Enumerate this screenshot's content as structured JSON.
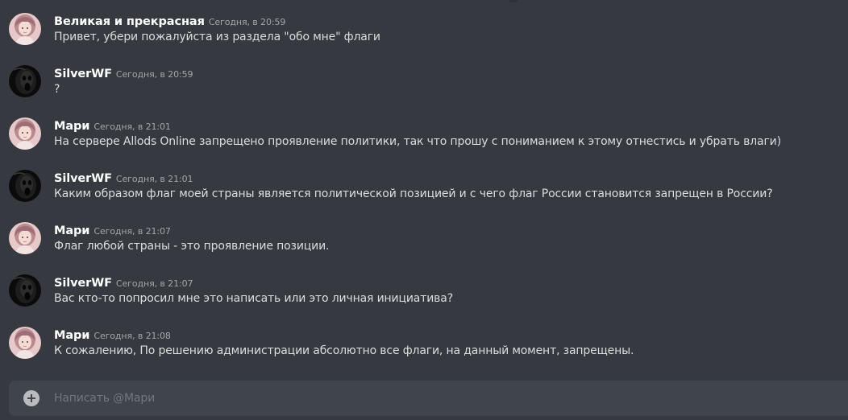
{
  "messages": [
    {
      "author": "Великая и прекрасная",
      "timestamp": "Сегодня, в 20:59",
      "text": "Привет, убери пожалуйста из раздела \"обо мне\" флаги",
      "avatar": "pink-haired-girl-avatar"
    },
    {
      "author": "SilverWF",
      "timestamp": "Сегодня, в 20:59",
      "text": "?",
      "avatar": "dark-creature-avatar"
    },
    {
      "author": "Мари",
      "timestamp": "Сегодня, в 21:01",
      "text": "На сервере Allods Online запрещено проявление политики, так что прошу с пониманием к этому отнестись и убрать влаги)",
      "avatar": "pink-haired-girl-avatar"
    },
    {
      "author": "SilverWF",
      "timestamp": "Сегодня, в 21:01",
      "text": "Каким образом флаг моей страны является политической позицией и с чего флаг России становится запрещен в России?",
      "avatar": "dark-creature-avatar"
    },
    {
      "author": "Мари",
      "timestamp": "Сегодня, в 21:07",
      "text": "Флаг любой страны - это проявление позиции.",
      "avatar": "pink-haired-girl-avatar"
    },
    {
      "author": "SilverWF",
      "timestamp": "Сегодня, в 21:07",
      "text": "Вас кто-то попросил мне это написать или это личная инициатива?",
      "avatar": "dark-creature-avatar"
    },
    {
      "author": "Мари",
      "timestamp": "Сегодня, в 21:08",
      "text": "К сожалению, По решению администрации абсолютно все флаги, на данный момент, запрещены.",
      "avatar": "pink-haired-girl-avatar"
    }
  ],
  "composer": {
    "placeholder": "Написать @Мари",
    "value": "",
    "add_icon": "plus-circle-icon"
  },
  "colors": {
    "background": "#36393f",
    "composer": "#40444b",
    "author": "#ffffff",
    "text": "#dcddde",
    "timestamp": "#a3a6aa",
    "placeholder": "#72767d"
  }
}
